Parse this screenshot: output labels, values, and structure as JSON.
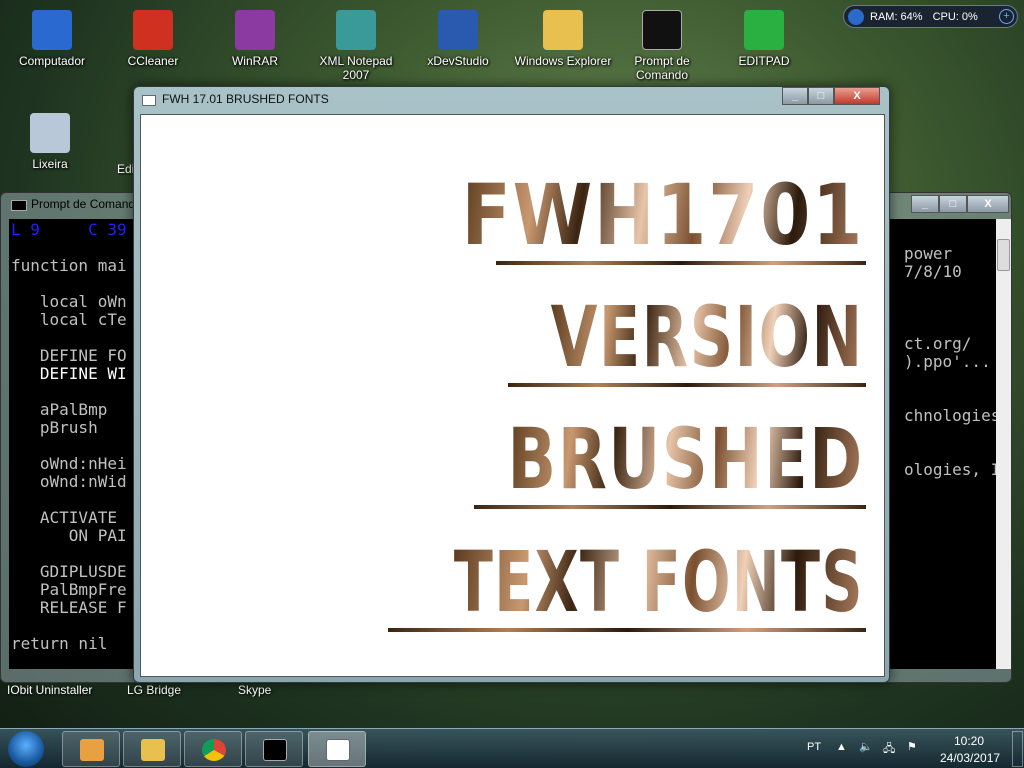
{
  "desktop": {
    "icons": [
      {
        "label": "Computador",
        "color": "#2a6ad0"
      },
      {
        "label": "CCleaner",
        "color": "#d03020"
      },
      {
        "label": "WinRAR",
        "color": "#8a3aa0"
      },
      {
        "label": "XML Notepad 2007",
        "color": "#3a9a9a"
      },
      {
        "label": "xDevStudio",
        "color": "#2a5ab0"
      },
      {
        "label": "Windows Explorer",
        "color": "#e8c050"
      },
      {
        "label": "Prompt de Comando",
        "color": "#111111"
      },
      {
        "label": "EDITPAD",
        "color": "#2ab040"
      },
      {
        "label": "Lixeira",
        "color": "#b8c8d8"
      },
      {
        "label": "Edi"
      }
    ],
    "bottom_labels": [
      "IObit Uninstaller",
      "LG Bridge",
      "Skype"
    ]
  },
  "sysmon": {
    "ram": "RAM: 64%",
    "cpu": "CPU: 0%"
  },
  "console": {
    "title": "Prompt de Comando",
    "left_lines": [
      "L 9     C 39",
      "",
      "function mai",
      "",
      "   local oWn",
      "   local cTe",
      "",
      "   DEFINE FO",
      "   DEFINE WI",
      "",
      "   aPalBmp",
      "   pBrush",
      "",
      "   oWnd:nHei",
      "   oWnd:nWid",
      "",
      "   ACTIVATE ",
      "      ON PAI",
      "",
      "   GDIPLUSDE",
      "   PalBmpFre",
      "   RELEASE F",
      "",
      "return nil"
    ],
    "right_lines": [
      "power",
      "7/8/10",
      "",
      "",
      "",
      "ct.org/",
      ").ppo'...",
      "",
      "",
      "chnologies,",
      "",
      "",
      "ologies, In"
    ]
  },
  "main_window": {
    "title": "FWH 17.01 BRUSHED FONTS",
    "lines": [
      "FWH1701",
      "VERSION",
      "BRUSHED",
      "TEXT FONTS"
    ]
  },
  "taskbar": {
    "lang": "PT",
    "time": "10:20",
    "date": "24/03/2017"
  }
}
